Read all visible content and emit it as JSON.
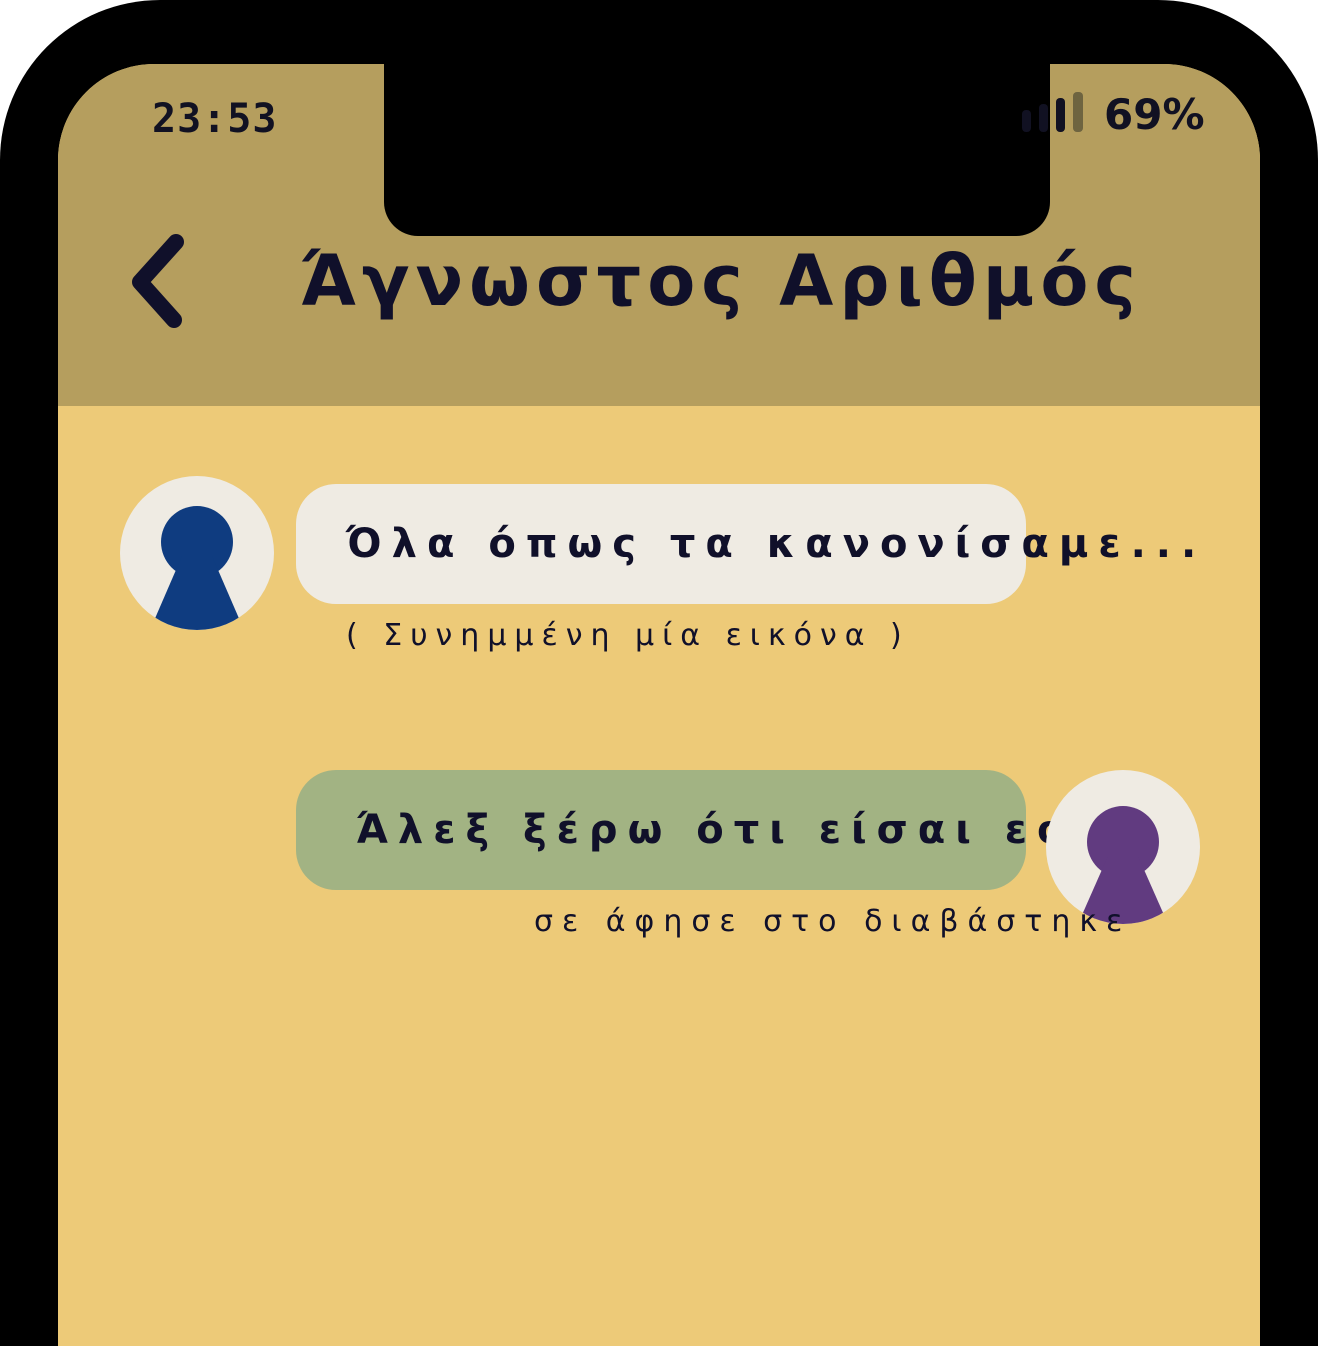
{
  "status_bar": {
    "time": "23:53",
    "battery": "69%",
    "signal_icon": "signal-bars-icon"
  },
  "header": {
    "back_icon": "chevron-left-icon",
    "title": "Άγνωστος Αριθμός"
  },
  "messages": [
    {
      "direction": "incoming",
      "text": "Όλα όπως τα κανονίσαμε...",
      "caption": "( Συνημμένη μία εικόνα )",
      "avatar_color": "#0F3C80"
    },
    {
      "direction": "outgoing",
      "text": "Άλεξ ξέρω ότι είσαι εσύ!!",
      "caption": "σε άφησε στο διαβάστηκε",
      "avatar_color": "#613B80"
    }
  ],
  "colors": {
    "frame": "#000000",
    "header": "#B59E5E",
    "background": "#EDCA78",
    "incoming_bubble": "#EFEBE3",
    "outgoing_bubble": "#A2B383",
    "text": "#10102A"
  }
}
